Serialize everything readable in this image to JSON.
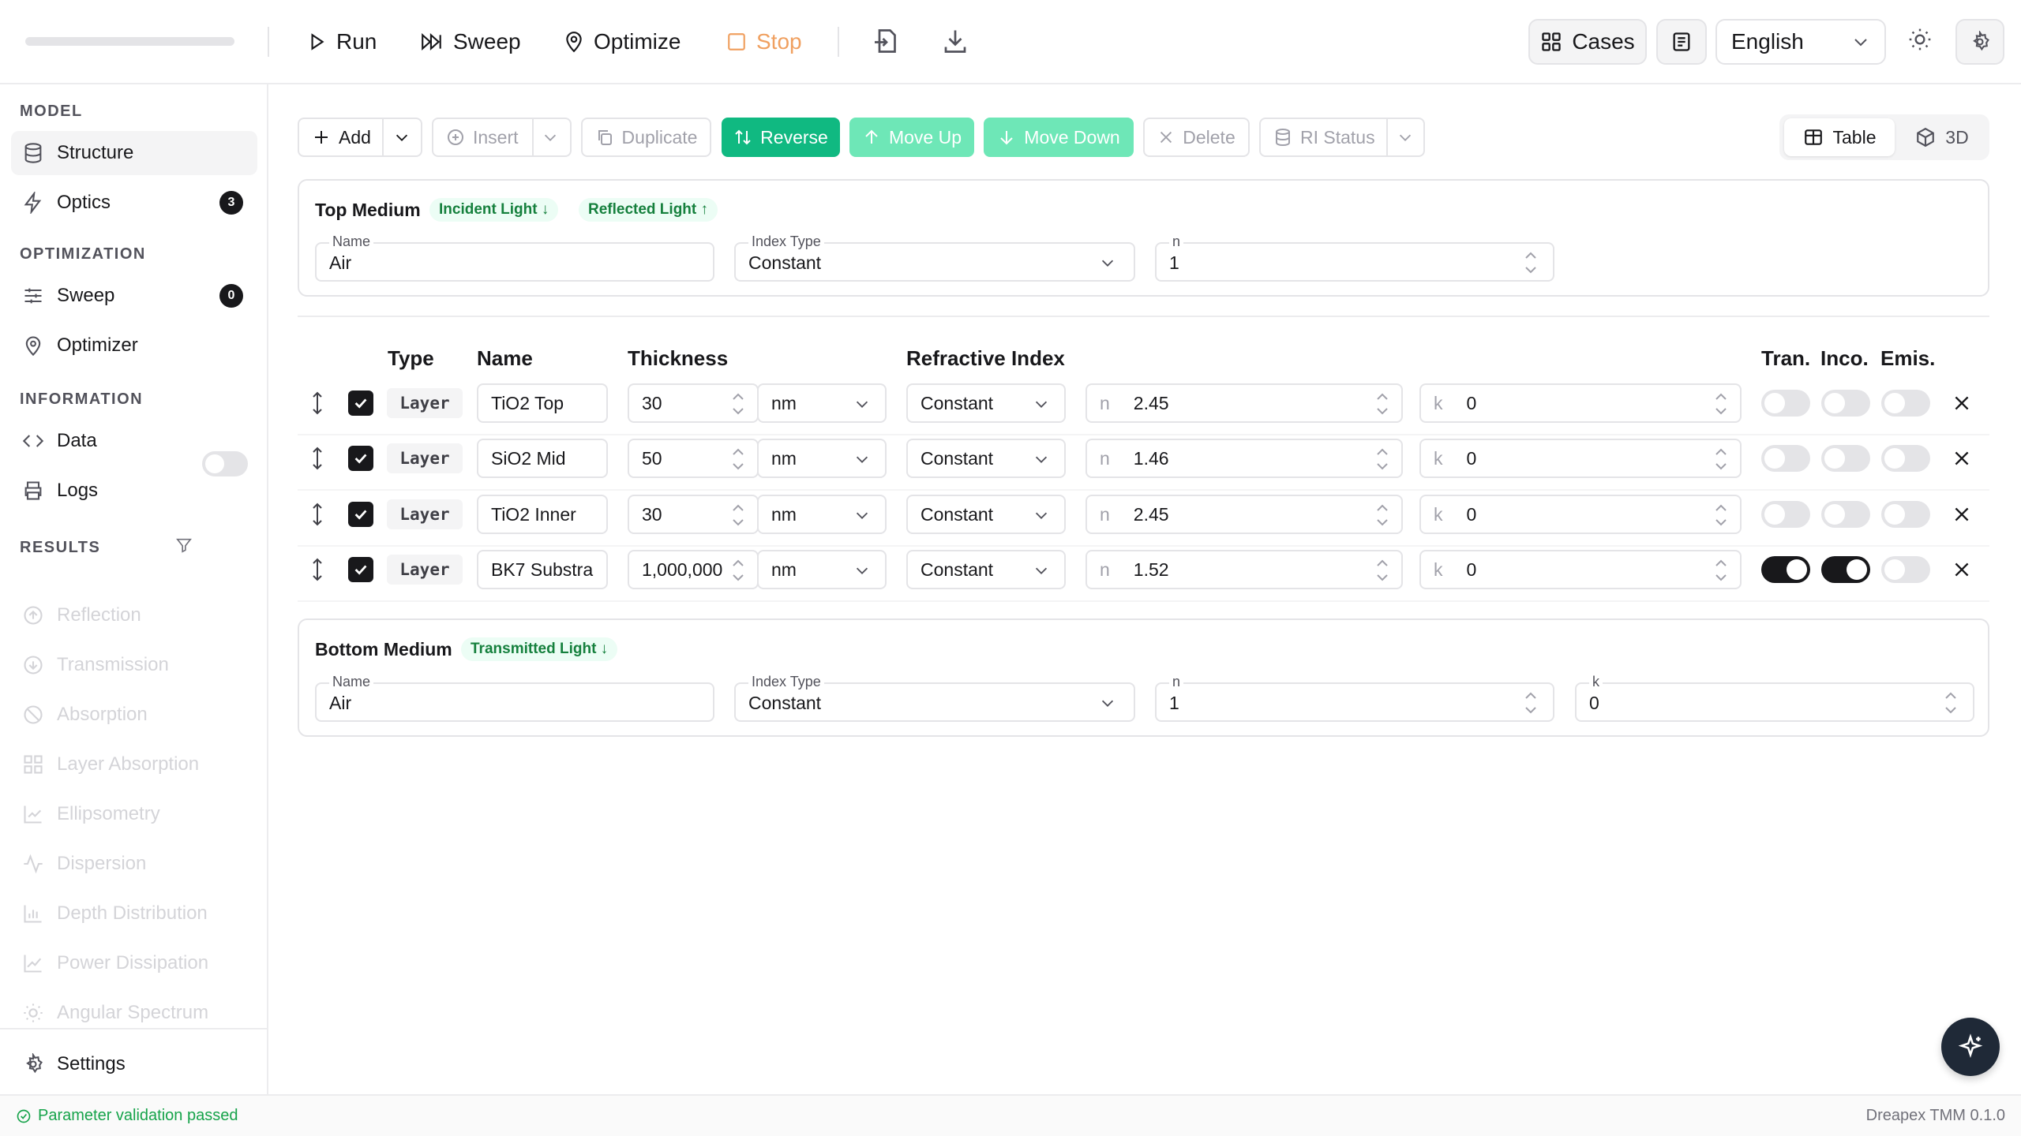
{
  "toolbar": {
    "run_label": "Run",
    "sweep_label": "Sweep",
    "optimize_label": "Optimize",
    "stop_label": "Stop",
    "cases_label": "Cases",
    "language": "English",
    "accent_color": "#10b981",
    "stop_color": "#f0a060"
  },
  "sidebar": {
    "sections": {
      "model": "MODEL",
      "optimization": "OPTIMIZATION",
      "information": "INFORMATION",
      "results": "RESULTS"
    },
    "model_items": [
      {
        "label": "Structure",
        "icon": "database-icon",
        "active": true
      },
      {
        "label": "Optics",
        "icon": "bolt-icon",
        "badge": "3"
      }
    ],
    "optimization_items": [
      {
        "label": "Sweep",
        "icon": "sliders-icon",
        "badge": "0"
      },
      {
        "label": "Optimizer",
        "icon": "map-pin-icon"
      }
    ],
    "information_items": [
      {
        "label": "Data",
        "icon": "code-icon"
      },
      {
        "label": "Logs",
        "icon": "printer-icon"
      }
    ],
    "results_items": [
      {
        "label": "Reflection",
        "icon": "arrow-circle-icon"
      },
      {
        "label": "Transmission",
        "icon": "arrow-circle-icon"
      },
      {
        "label": "Absorption",
        "icon": "ban-icon"
      },
      {
        "label": "Layer Absorption",
        "icon": "grid-icon"
      },
      {
        "label": "Ellipsometry",
        "icon": "line-chart-icon"
      },
      {
        "label": "Dispersion",
        "icon": "pulse-icon"
      },
      {
        "label": "Depth Distribution",
        "icon": "bar-chart-icon"
      },
      {
        "label": "Power Dissipation",
        "icon": "area-chart-icon"
      },
      {
        "label": "Angular Spectrum",
        "icon": "sun-icon"
      }
    ],
    "settings_label": "Settings"
  },
  "actions": {
    "add": "Add",
    "insert": "Insert",
    "duplicate": "Duplicate",
    "reverse": "Reverse",
    "move_up": "Move Up",
    "move_down": "Move Down",
    "delete": "Delete",
    "ri_status": "RI Status",
    "view_table": "Table",
    "view_3d": "3D"
  },
  "top_medium": {
    "title": "Top Medium",
    "tags": [
      "Incident Light ↓",
      "Reflected Light ↑"
    ],
    "name_label": "Name",
    "name": "Air",
    "index_type_label": "Index Type",
    "index_type": "Constant",
    "n_label": "n",
    "n": "1"
  },
  "table": {
    "headers": {
      "type": "Type",
      "name": "Name",
      "thickness": "Thickness",
      "refractive_index": "Refractive Index",
      "tran": "Tran.",
      "inco": "Inco.",
      "emis": "Emis."
    },
    "rows": [
      {
        "type": "Layer",
        "name": "TiO2 Top",
        "thickness": "30",
        "unit": "nm",
        "index_type": "Constant",
        "n_prefix": "n",
        "n": "2.45",
        "k_prefix": "k",
        "k": "0",
        "checked": true,
        "tran": false,
        "inco": false,
        "emis": false
      },
      {
        "type": "Layer",
        "name": "SiO2 Mid",
        "thickness": "50",
        "unit": "nm",
        "index_type": "Constant",
        "n_prefix": "n",
        "n": "1.46",
        "k_prefix": "k",
        "k": "0",
        "checked": true,
        "tran": false,
        "inco": false,
        "emis": false
      },
      {
        "type": "Layer",
        "name": "TiO2 Inner",
        "thickness": "30",
        "unit": "nm",
        "index_type": "Constant",
        "n_prefix": "n",
        "n": "2.45",
        "k_prefix": "k",
        "k": "0",
        "checked": true,
        "tran": false,
        "inco": false,
        "emis": false
      },
      {
        "type": "Layer",
        "name": "BK7 Substra",
        "thickness": "1,000,000",
        "unit": "nm",
        "index_type": "Constant",
        "n_prefix": "n",
        "n": "1.52",
        "k_prefix": "k",
        "k": "0",
        "checked": true,
        "tran": true,
        "inco": true,
        "emis": false
      }
    ]
  },
  "bottom_medium": {
    "title": "Bottom Medium",
    "tags": [
      "Transmitted Light ↓"
    ],
    "name_label": "Name",
    "name": "Air",
    "index_type_label": "Index Type",
    "index_type": "Constant",
    "n_label": "n",
    "n": "1",
    "k_label": "k",
    "k": "0"
  },
  "status": {
    "message": "Parameter validation passed",
    "version": "Dreapex TMM 0.1.0"
  }
}
